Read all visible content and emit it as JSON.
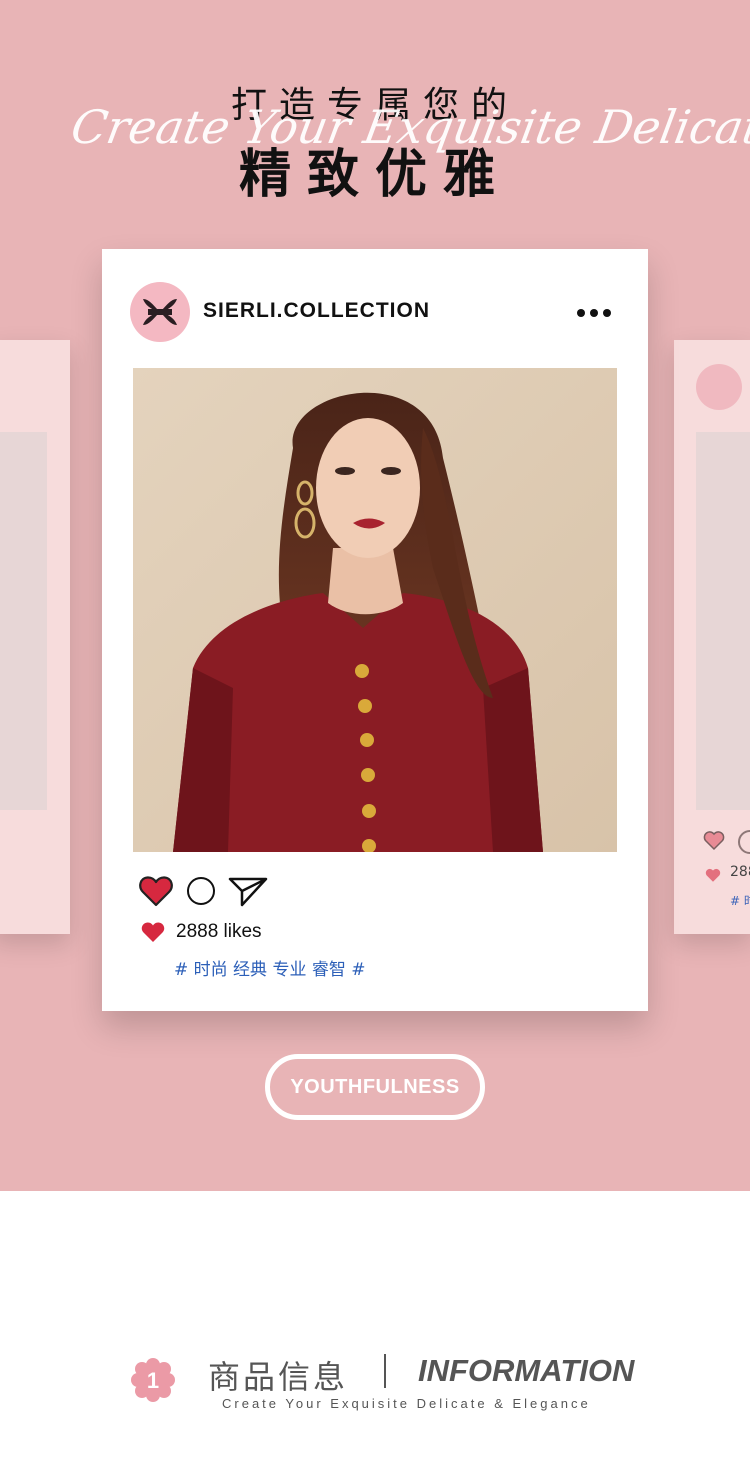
{
  "hero": {
    "title_top": "打造专属您的",
    "script_line": "Create Your Exquisite Delicate & Elegance",
    "title_main": "精致优雅",
    "background_color": "#e8b4b6"
  },
  "post": {
    "handle": "SIERLI.COLLECTION",
    "likes": "2888 likes",
    "tags": "# 时尚 经典 专业 睿智 #",
    "heart_color": "#d6283f",
    "tag_color": "#2c5fb8"
  },
  "side_right": {
    "likes_partial": "288",
    "tags_partial": "# 时"
  },
  "youthfulness_label": "YOUTHFULNESS",
  "info": {
    "number": "1",
    "cn_title": "商品信息",
    "en_title": "INFORMATION",
    "subtitle": "Create Your Exquisite Delicate & Elegance"
  }
}
